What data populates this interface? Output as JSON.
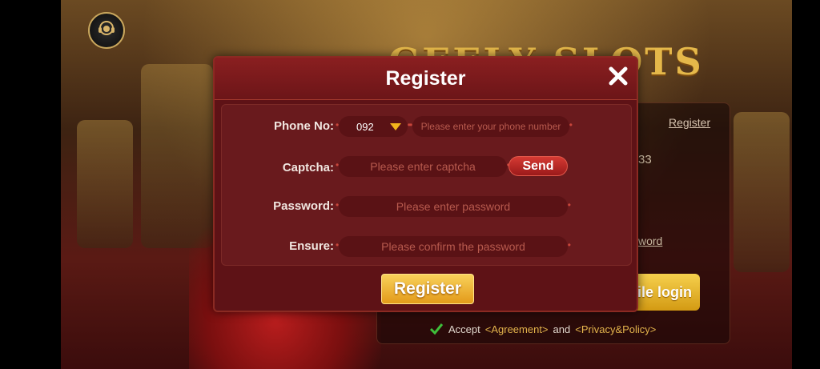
{
  "background": {
    "logo_text": "GEELY SLOTS",
    "panel_register_link": "Register",
    "panel_partial_number": "33",
    "panel_partial_forgot": "word",
    "mobile_login_label": "bile login",
    "accept_text": "Accept",
    "agreement_link": "<Agreement>",
    "and_text": "and",
    "privacy_link": "<Privacy&Policy>"
  },
  "dialog": {
    "title": "Register",
    "phone_label": "Phone No:",
    "country_code": "092",
    "phone_placeholder": "Please enter your phone number",
    "captcha_label": "Captcha:",
    "captcha_placeholder": "Please enter captcha",
    "send_label": "Send",
    "password_label": "Password:",
    "password_placeholder": "Please enter password",
    "ensure_label": "Ensure:",
    "ensure_placeholder": "Please confirm the password",
    "register_button": "Register"
  },
  "colors": {
    "dialog_bg": "#5e1216",
    "accent_gold": "#e3b44c",
    "send_red": "#c52a26",
    "register_gold": "#f0b83a"
  },
  "icons": [
    "headset-icon",
    "close-icon",
    "dropdown-caret-icon",
    "check-icon"
  ]
}
